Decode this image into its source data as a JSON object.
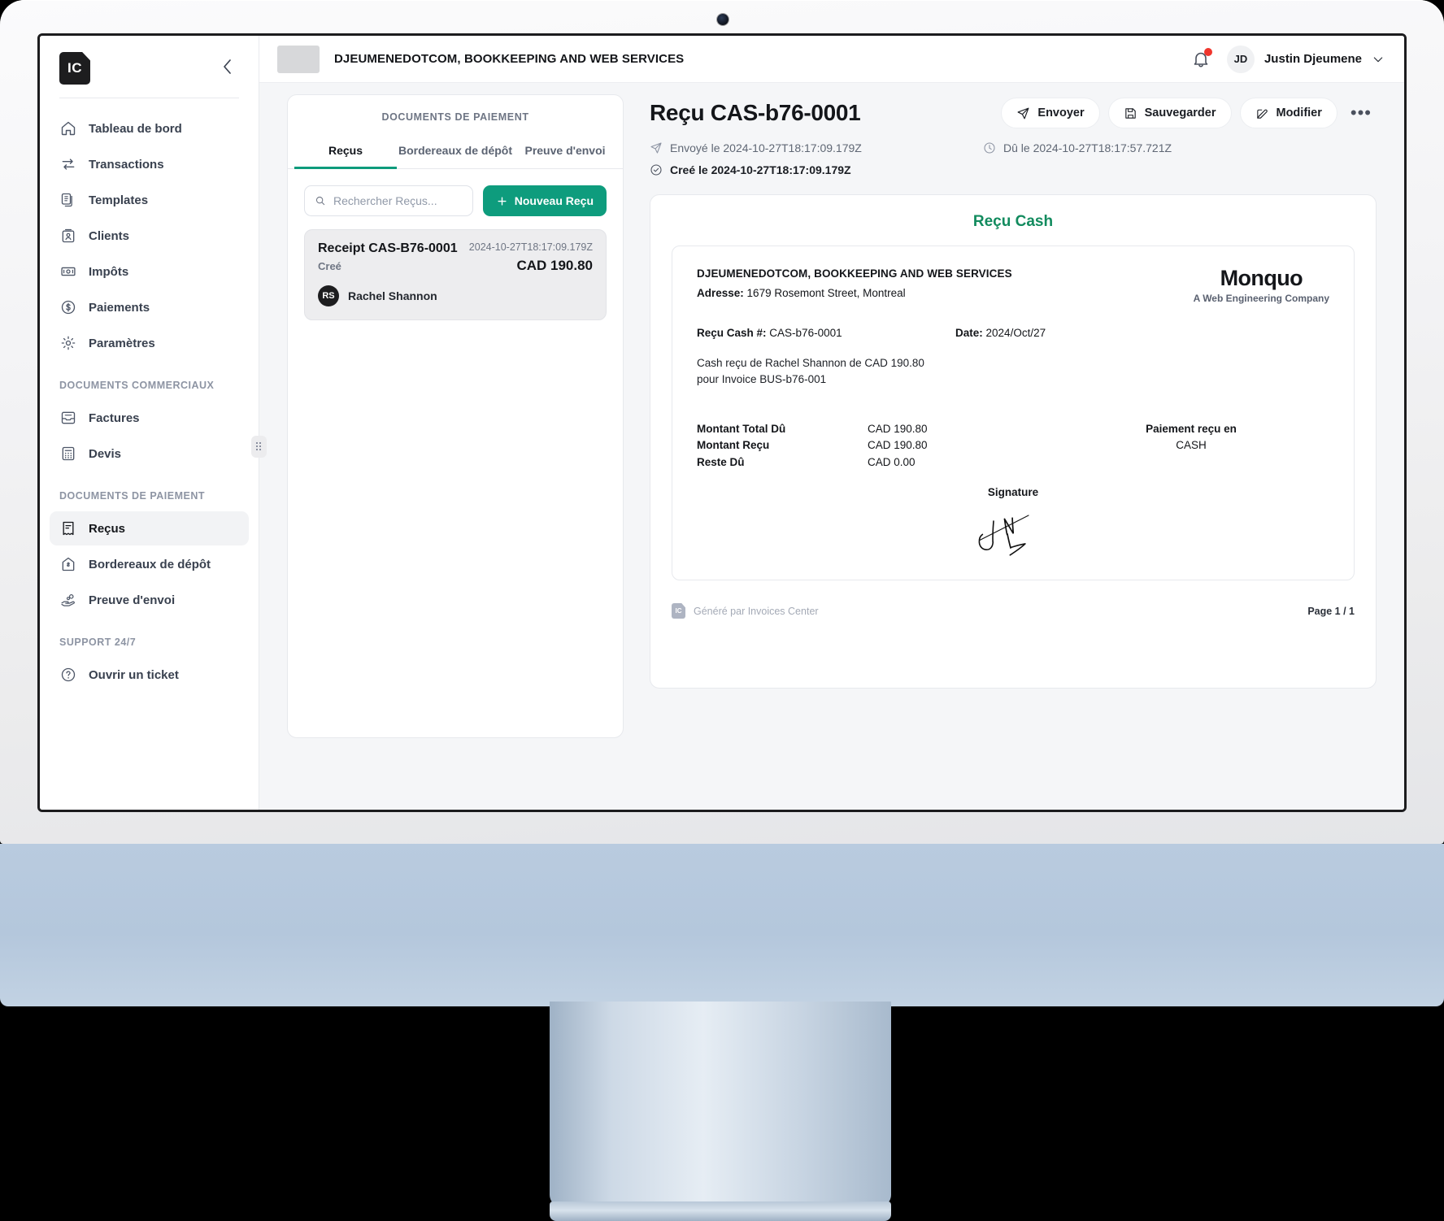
{
  "topbar": {
    "org_name": "DJEUMENEDOTCOM, BOOKKEEPING AND WEB SERVICES",
    "user_initials": "JD",
    "user_name": "Justin Djeumene",
    "notification_badge": "",
    "chevron": "⌄"
  },
  "sidebar": {
    "logo_text": "IC",
    "collapse_icon": "chevron-left",
    "main_items": [
      {
        "label": "Tableau de bord",
        "icon": "home-icon"
      },
      {
        "label": "Transactions",
        "icon": "transfer-icon"
      },
      {
        "label": "Templates",
        "icon": "copy-documents-icon"
      },
      {
        "label": "Clients",
        "icon": "id-card-icon"
      },
      {
        "label": "Impôts",
        "icon": "banknote-icon"
      },
      {
        "label": "Paiements",
        "icon": "dollar-circle-icon"
      },
      {
        "label": "Paramètres",
        "icon": "gear-icon"
      }
    ],
    "section_commercial": "DOCUMENTS COMMERCIAUX",
    "commercial_items": [
      {
        "label": "Factures",
        "icon": "inbox-icon"
      },
      {
        "label": "Devis",
        "icon": "calculator-icon"
      }
    ],
    "section_payment": "DOCUMENTS DE PAIEMENT",
    "payment_items": [
      {
        "label": "Reçus",
        "icon": "receipt-icon",
        "active": true
      },
      {
        "label": "Bordereaux de dépôt",
        "icon": "deposit-icon",
        "active": false
      },
      {
        "label": "Preuve d'envoi",
        "icon": "hand-coins-icon",
        "active": false
      }
    ],
    "section_support": "SUPPORT 24/7",
    "support_items": [
      {
        "label": "Ouvrir un ticket",
        "icon": "question-circle-icon"
      }
    ]
  },
  "list_panel": {
    "title": "DOCUMENTS DE PAIEMENT",
    "tabs": [
      {
        "label": "Reçus",
        "active": true
      },
      {
        "label": "Bordereaux de dépôt",
        "active": false
      },
      {
        "label": "Preuve d'envoi",
        "active": false
      }
    ],
    "search_placeholder": "Rechercher Reçus...",
    "search_value": "",
    "new_button": "Nouveau Reçu",
    "new_button_icon": "plus-icon",
    "items": [
      {
        "name": "Receipt CAS-B76-0001",
        "date": "2024-10-27T18:17:09.179Z",
        "status": "Creé",
        "amount": "CAD 190.80",
        "client_initials": "RS",
        "client_name": "Rachel Shannon"
      }
    ]
  },
  "detail": {
    "title": "Reçu CAS-b76-0001",
    "actions": [
      {
        "label": "Envoyer",
        "icon": "send-icon"
      },
      {
        "label": "Sauvegarder",
        "icon": "save-icon"
      },
      {
        "label": "Modifier",
        "icon": "edit-icon"
      }
    ],
    "more_icon": "•••",
    "meta": {
      "sent": "Envoyé le 2024-10-27T18:17:09.179Z",
      "due": "Dû le 2024-10-27T18:17:57.721Z",
      "created": "Creé le 2024-10-27T18:17:09.179Z"
    },
    "document": {
      "heading": "Reçu Cash",
      "business_name": "DJEUMENEDOTCOM, BOOKKEEPING AND WEB SERVICES",
      "address_label": "Adresse:",
      "address_value": "1679 Rosemont Street, Montreal",
      "brand_name": "Monquo",
      "brand_tagline": "A Web Engineering Company",
      "receipt_no_label": "Reçu Cash #:",
      "receipt_no_value": "CAS-b76-0001",
      "date_label": "Date:",
      "date_value": "2024/Oct/27",
      "description_line1": "Cash reçu de Rachel Shannon de CAD 190.80",
      "description_line2": "pour Invoice BUS-b76-001",
      "totals": [
        {
          "label": "Montant Total Dû",
          "value": "CAD 190.80"
        },
        {
          "label": "Montant Reçu",
          "value": "CAD 190.80"
        },
        {
          "label": "Reste Dû",
          "value": "CAD 0.00"
        }
      ],
      "payment_method_label": "Paiement reçu en",
      "payment_method_value": "CASH",
      "signature_label": "Signature",
      "footer_logo": "IC",
      "footer_text": "Généré par Invoices Center",
      "page_label": "Page 1 / 1"
    }
  },
  "colors": {
    "accent_green": "#0e9c7d",
    "heading_green": "#128b5e",
    "notification_red": "#f0362d",
    "screen_bg": "#f5f6f8"
  }
}
